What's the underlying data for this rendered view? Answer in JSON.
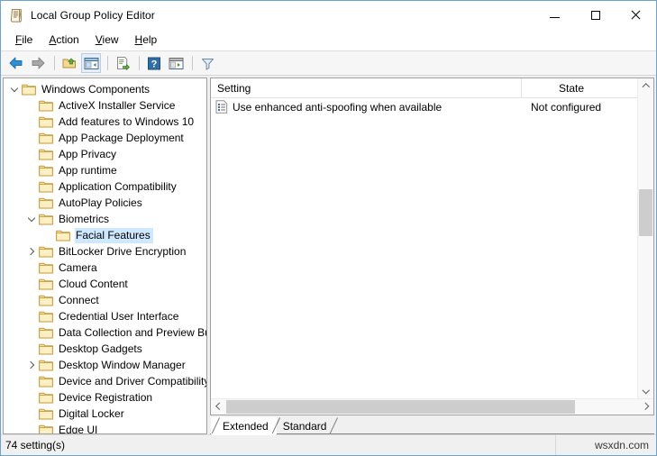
{
  "window": {
    "title": "Local Group Policy Editor",
    "title_icon": "policy-document-icon",
    "accent": "#6ba4d0",
    "minimize_label": "—",
    "maximize_label": "□",
    "close_label": "✕"
  },
  "menu": {
    "items": [
      {
        "label": "File",
        "accel": "F"
      },
      {
        "label": "Action",
        "accel": "A"
      },
      {
        "label": "View",
        "accel": "V"
      },
      {
        "label": "Help",
        "accel": "H"
      }
    ]
  },
  "toolbar": {
    "buttons": [
      {
        "name": "back-icon",
        "tip": "Back"
      },
      {
        "name": "forward-icon",
        "tip": "Forward"
      },
      {
        "name": "up-one-level-icon",
        "tip": "Up one level"
      },
      {
        "name": "show-hide-tree-icon",
        "tip": "Show/Hide Console Tree",
        "active": true
      },
      {
        "name": "export-list-icon",
        "tip": "Export List"
      },
      {
        "name": "help-icon",
        "tip": "Help"
      },
      {
        "name": "show-action-pane-icon",
        "tip": "Show/Hide Action Pane"
      },
      {
        "name": "filter-icon",
        "tip": "Filter"
      }
    ]
  },
  "tree": {
    "selected_label": "Facial Features",
    "highlight_color": "#cde8ff",
    "items": [
      {
        "label": "Windows Components",
        "indent": 0,
        "expander": "down"
      },
      {
        "label": "ActiveX Installer Service",
        "indent": 1,
        "expander": "none"
      },
      {
        "label": "Add features to Windows 10",
        "indent": 1,
        "expander": "none"
      },
      {
        "label": "App Package Deployment",
        "indent": 1,
        "expander": "none"
      },
      {
        "label": "App Privacy",
        "indent": 1,
        "expander": "none"
      },
      {
        "label": "App runtime",
        "indent": 1,
        "expander": "none"
      },
      {
        "label": "Application Compatibility",
        "indent": 1,
        "expander": "none"
      },
      {
        "label": "AutoPlay Policies",
        "indent": 1,
        "expander": "none"
      },
      {
        "label": "Biometrics",
        "indent": 1,
        "expander": "down"
      },
      {
        "label": "Facial Features",
        "indent": 2,
        "expander": "none",
        "selected": true
      },
      {
        "label": "BitLocker Drive Encryption",
        "indent": 1,
        "expander": "right"
      },
      {
        "label": "Camera",
        "indent": 1,
        "expander": "none"
      },
      {
        "label": "Cloud Content",
        "indent": 1,
        "expander": "none"
      },
      {
        "label": "Connect",
        "indent": 1,
        "expander": "none"
      },
      {
        "label": "Credential User Interface",
        "indent": 1,
        "expander": "none"
      },
      {
        "label": "Data Collection and Preview Build",
        "indent": 1,
        "expander": "none"
      },
      {
        "label": "Desktop Gadgets",
        "indent": 1,
        "expander": "none"
      },
      {
        "label": "Desktop Window Manager",
        "indent": 1,
        "expander": "right"
      },
      {
        "label": "Device and Driver Compatibility",
        "indent": 1,
        "expander": "none"
      },
      {
        "label": "Device Registration",
        "indent": 1,
        "expander": "none"
      },
      {
        "label": "Digital Locker",
        "indent": 1,
        "expander": "none"
      },
      {
        "label": "Edge UI",
        "indent": 1,
        "expander": "none"
      }
    ]
  },
  "list": {
    "columns": [
      {
        "key": "setting",
        "label": "Setting"
      },
      {
        "key": "state",
        "label": "State"
      }
    ],
    "rows": [
      {
        "icon": "policy-setting-icon",
        "setting": "Use enhanced anti-spoofing when available",
        "state": "Not configured"
      }
    ]
  },
  "tabs": {
    "items": [
      {
        "label": "Extended",
        "selected": true
      },
      {
        "label": "Standard",
        "selected": false
      }
    ]
  },
  "statusbar": {
    "text": "74 setting(s)",
    "watermark": "wsxdn.com"
  }
}
